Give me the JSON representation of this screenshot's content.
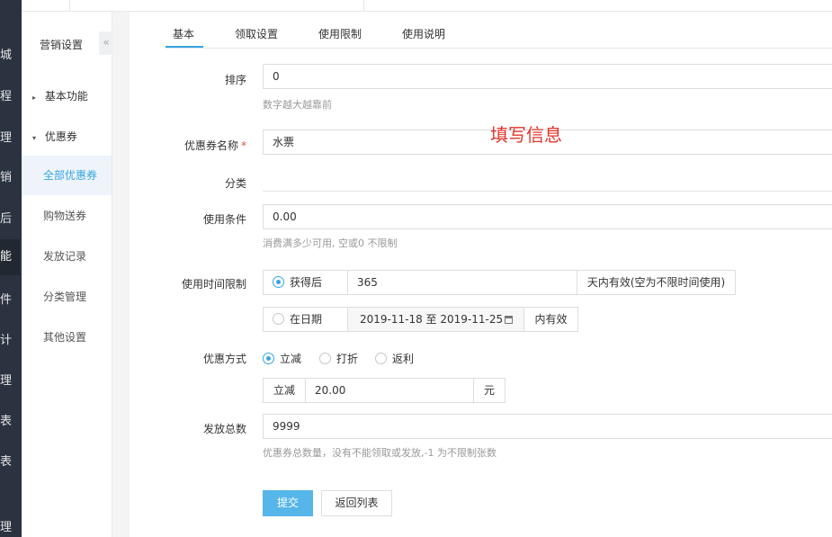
{
  "rail": {
    "items": [
      "城",
      "程",
      "理",
      "销",
      "后",
      "能",
      "件",
      "计",
      "理",
      "表",
      "表",
      "理"
    ]
  },
  "sidebar": {
    "title": "营销设置",
    "collapse_glyph": "«",
    "groups": [
      {
        "label": "基本功能",
        "arrow": "▸"
      },
      {
        "label": "优惠券",
        "arrow": "▾"
      }
    ],
    "items": [
      {
        "label": "全部优惠券"
      },
      {
        "label": "购物送券"
      },
      {
        "label": "发放记录"
      },
      {
        "label": "分类管理"
      },
      {
        "label": "其他设置"
      }
    ]
  },
  "tabs": [
    {
      "label": "基本"
    },
    {
      "label": "领取设置"
    },
    {
      "label": "使用限制"
    },
    {
      "label": "使用说明"
    }
  ],
  "annotation": "填写信息",
  "form": {
    "sort": {
      "label": "排序",
      "value": "0",
      "help": "数字越大越靠前"
    },
    "name": {
      "label": "优惠券名称",
      "required_mark": "*",
      "value": "水票"
    },
    "category": {
      "label": "分类"
    },
    "condition": {
      "label": "使用条件",
      "value": "0.00",
      "help": "消费满多少可用, 空或0 不限制"
    },
    "time_limit": {
      "label": "使用时间限制",
      "option_after": "获得后",
      "after_days": "365",
      "after_suffix": "天内有效(空为不限时间使用)",
      "option_date": "在日期",
      "date_range": "2019-11-18 至 2019-11-25",
      "date_suffix": "内有效"
    },
    "discount": {
      "label": "优惠方式",
      "options": [
        "立减",
        "打折",
        "返利"
      ],
      "selected": "立减",
      "prefix": "立减",
      "value": "20.00",
      "suffix": "元"
    },
    "total": {
      "label": "发放总数",
      "value": "9999",
      "help": "优惠券总数量，没有不能领取或发放,-1 为不限制张数"
    }
  },
  "buttons": {
    "submit": "提交",
    "back": "返回列表"
  },
  "colors": {
    "accent": "#36a5e0",
    "primary_button": "#56b5e9",
    "annotation": "#e0352b",
    "rail": "#2b3340"
  }
}
